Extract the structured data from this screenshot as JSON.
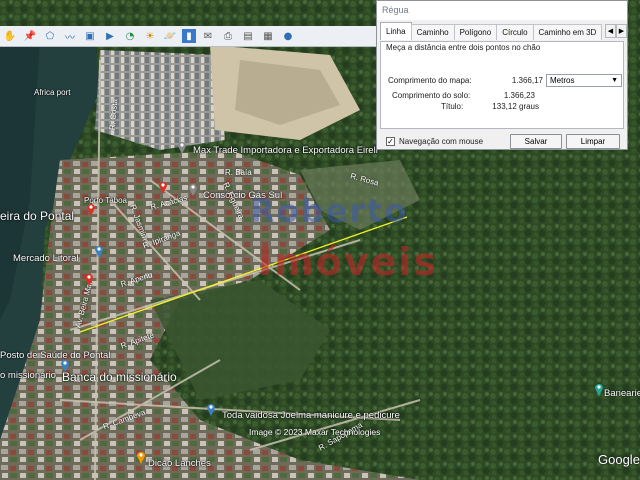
{
  "dialog": {
    "title": "Régua",
    "tabs": [
      "Linha",
      "Caminho",
      "Polígono",
      "Círculo",
      "Caminho em 3D"
    ],
    "active_tab": "Linha",
    "description": "Meça a distância entre dois pontos no chão",
    "map_length_label": "Comprimento do mapa:",
    "map_length_value": "1.366,17",
    "unit_selected": "Metros",
    "ground_length_label": "Comprimento do solo:",
    "ground_length_value": "1.366,23",
    "heading_label": "Título:",
    "heading_value": "133,12 graus",
    "mouse_nav_label": "Navegação com mouse",
    "mouse_nav_checked": true,
    "save_label": "Salvar",
    "clear_label": "Limpar",
    "prev_arrow": "◀",
    "next_arrow": "▶"
  },
  "toolbar": {
    "icons": [
      "hand-icon",
      "placemark-icon",
      "polygon-icon",
      "path-icon",
      "overlay-icon",
      "tour-icon",
      "history-icon",
      "sun-icon",
      "planets-icon",
      "ruler-icon",
      "email-icon",
      "print-icon",
      "save-image-icon",
      "maps-icon",
      "earth-icon"
    ]
  },
  "map": {
    "labels": {
      "port": "Africa port",
      "feira": "eira do Pontal",
      "mercado": "Mercado Litoral",
      "posto": "Posto de Saúde do Pontal",
      "missionario_left": "o missionário",
      "banca": "Banca do missionário",
      "comercio": "Max Trade Importadora e Exportadora Eireli",
      "consorcio": "Consórcio Gás Sul",
      "porto_taboa": "Porto Taboa",
      "toda_vaidosa": "Toda vaidosa Joelma manicure e pedicure",
      "dicao": "Dicão Lanches",
      "banearios": "Banearie"
    },
    "streets": {
      "r_acacias": "R. Acácias",
      "r_jasmim": "R. Jasmim",
      "r_apenu": "R. Apenu",
      "r_ipiranga": "R. Ipiranga",
      "av_beira_mar": "Av. Beira Mar",
      "r_apitete": "R. Apitete",
      "r_cambevas": "R. Cambeva",
      "r_sapopema": "R. Sapopema",
      "r_baia": "R. Baía",
      "r_rosa": "R. Rosa",
      "r_figueira": "R. Figueira",
      "r_costa": "R. Costa"
    },
    "watermark_top": "Roberto",
    "watermark_bottom": "Imóveis",
    "copyright": "Image © 2023 Maxar Technologies",
    "brand": "Google",
    "measure_line_color": "#f5f524"
  }
}
